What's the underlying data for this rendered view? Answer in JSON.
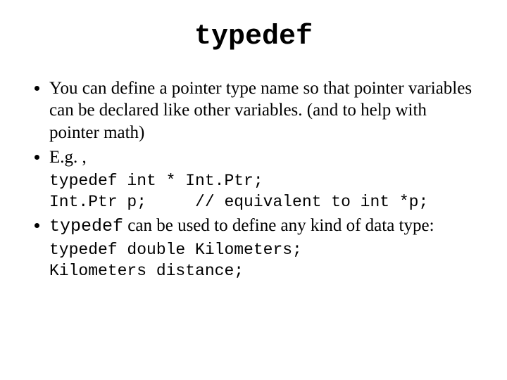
{
  "title": "typedef",
  "bullets": {
    "b1": "You can define a pointer type name so that pointer variables can be declared like other variables. (and to help with pointer math)",
    "b2": "E.g. ,",
    "code1_line1": "typedef int * Int.Ptr;",
    "code1_line2": "Int.Ptr p;     // equivalent to int *p;",
    "b3_code": "typedef",
    "b3_rest": " can be used to define any kind of data type:",
    "code2_line1": "typedef double Kilometers;",
    "code2_line2": "Kilometers distance;"
  }
}
